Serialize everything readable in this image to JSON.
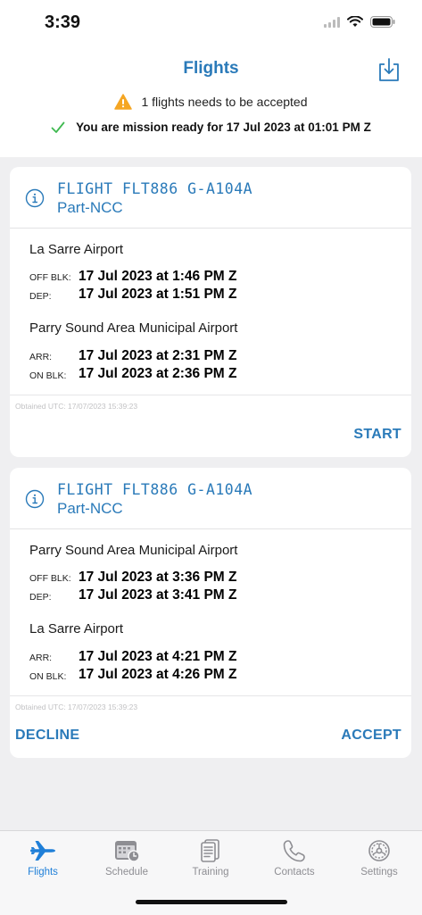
{
  "status_bar": {
    "time": "3:39"
  },
  "header": {
    "title": "Flights",
    "alert_text": "1 flights needs to be accepted",
    "ready_text": "You are mission ready for 17 Jul 2023 at 01:01 PM Z"
  },
  "flights": [
    {
      "title": "FLIGHT FLT886 G-A104A",
      "subtitle": "Part-NCC",
      "origin": "La Sarre Airport",
      "off_blk_label": "OFF BLK:",
      "off_blk": "17 Jul 2023 at 1:46 PM Z",
      "dep_label": "DEP:",
      "dep": "17 Jul 2023 at 1:51 PM Z",
      "destination": "Parry Sound Area Municipal Airport",
      "arr_label": "ARR:",
      "arr": "17 Jul 2023 at 2:31 PM Z",
      "on_blk_label": "ON BLK:",
      "on_blk": "17 Jul 2023 at 2:36 PM Z",
      "obtained": "Obtained UTC: 17/07/2023 15:39:23",
      "start_label": "START"
    },
    {
      "title": "FLIGHT FLT886 G-A104A",
      "subtitle": "Part-NCC",
      "origin": "Parry Sound Area Municipal Airport",
      "off_blk_label": "OFF BLK:",
      "off_blk": "17 Jul 2023 at 3:36 PM Z",
      "dep_label": "DEP:",
      "dep": "17 Jul 2023 at 3:41 PM Z",
      "destination": "La Sarre Airport",
      "arr_label": "ARR:",
      "arr": "17 Jul 2023 at 4:21 PM Z",
      "on_blk_label": "ON BLK:",
      "on_blk": "17 Jul 2023 at 4:26 PM Z",
      "obtained": "Obtained UTC: 17/07/2023 15:39:23",
      "decline_label": "DECLINE",
      "accept_label": "ACCEPT"
    }
  ],
  "tabs": [
    {
      "label": "Flights",
      "icon": "airplane-icon",
      "active": true
    },
    {
      "label": "Schedule",
      "icon": "calendar-clock-icon",
      "active": false
    },
    {
      "label": "Training",
      "icon": "document-icon",
      "active": false
    },
    {
      "label": "Contacts",
      "icon": "phone-icon",
      "active": false
    },
    {
      "label": "Settings",
      "icon": "gear-icon",
      "active": false
    }
  ],
  "colors": {
    "accent": "#2a7ab9",
    "tab_active": "#1f7fd8",
    "warning": "#f5a623",
    "success": "#3fb950"
  }
}
